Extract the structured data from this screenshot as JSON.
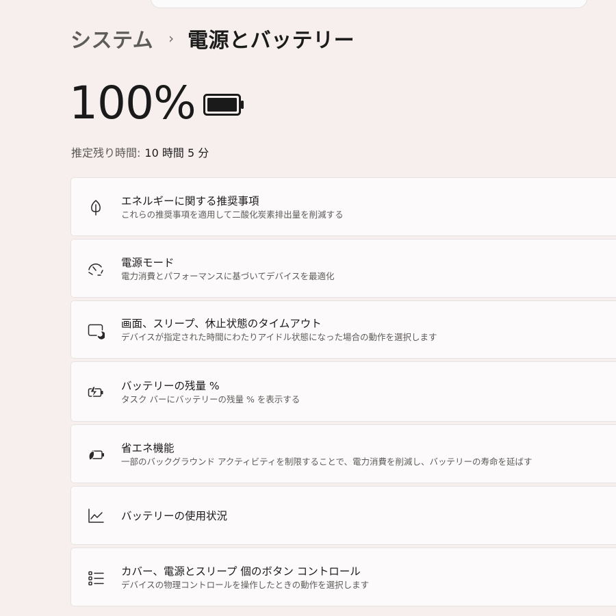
{
  "breadcrumb": {
    "parent": "システム",
    "separator": "›",
    "current": "電源とバッテリー"
  },
  "battery": {
    "level_text": "100%",
    "level_fraction": 1.0,
    "remaining_label": "推定残り時間:",
    "remaining_value": "10 時間 5 分"
  },
  "settings": [
    {
      "icon": "leaf-icon",
      "title": "エネルギーに関する推奨事項",
      "description": "これらの推奨事項を適用して二酸化炭素排出量を削減する"
    },
    {
      "icon": "power-mode-gauge-icon",
      "title": "電源モード",
      "description": "電力消費とパフォーマンスに基づいてデバイスを最適化"
    },
    {
      "icon": "screen-sleep-icon",
      "title": "画面、スリープ、休止状態のタイムアウト",
      "description": "デバイスが指定された時間にわたりアイドル状態になった場合の動作を選択します"
    },
    {
      "icon": "battery-charging-icon",
      "title": "バッテリーの残量 %",
      "description": "タスク バーにバッテリーの残量 % を表示する"
    },
    {
      "icon": "energy-saver-icon",
      "title": "省エネ機能",
      "description": "一部のバックグラウンド アクティビティを制限することで、電力消費を削減し、バッテリーの寿命を延ばす"
    },
    {
      "icon": "usage-chart-icon",
      "title": "バッテリーの使用状況",
      "description": ""
    },
    {
      "icon": "list-icon",
      "title": "カバー、電源とスリープ 個のボタン コントロール",
      "description": "デバイスの物理コントロールを操作したときの動作を選択します"
    }
  ]
}
